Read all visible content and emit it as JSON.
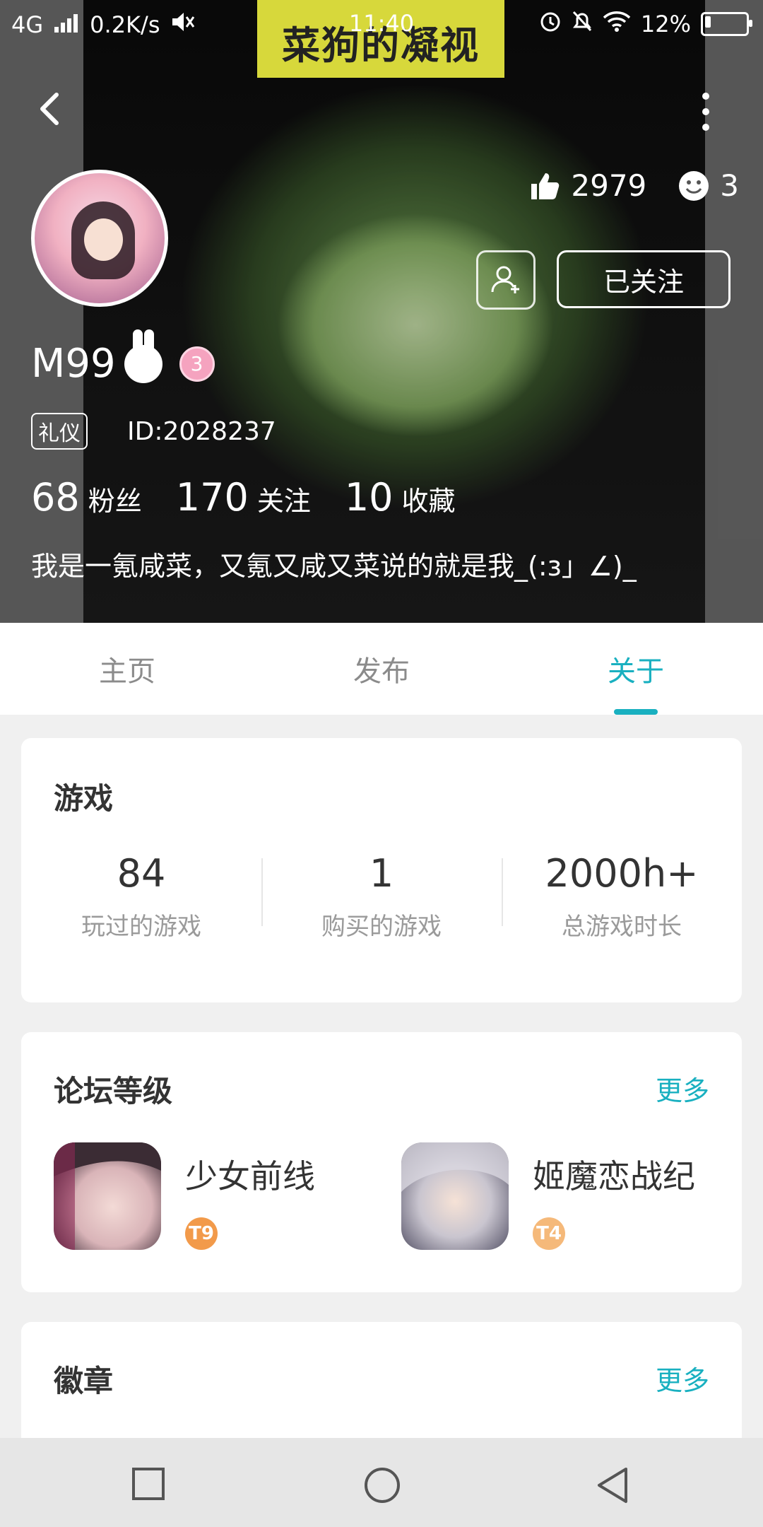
{
  "status_bar": {
    "network": "4G",
    "speed": "0.2K/s",
    "time": "11:40",
    "battery": "12%"
  },
  "header": {
    "overlay_title": "菜狗的凝视",
    "likes": "2979",
    "reactions": "3",
    "follow_label": "已关注",
    "username": "M99",
    "level_badge": "3",
    "tag": "礼仪",
    "user_id": "ID:2028237",
    "counts": [
      {
        "num": "68",
        "label": "粉丝"
      },
      {
        "num": "170",
        "label": "关注"
      },
      {
        "num": "10",
        "label": "收藏"
      }
    ],
    "bio": "我是一氪咸菜，又氪又咸又菜说的就是我_(:з」∠)_"
  },
  "tabs": [
    {
      "label": "主页",
      "active": false
    },
    {
      "label": "发布",
      "active": false
    },
    {
      "label": "关于",
      "active": true
    }
  ],
  "games_card": {
    "title": "游戏",
    "stats": [
      {
        "num": "84",
        "label": "玩过的游戏"
      },
      {
        "num": "1",
        "label": "购买的游戏"
      },
      {
        "num": "2000h+",
        "label": "总游戏时长"
      }
    ]
  },
  "forum_card": {
    "title": "论坛等级",
    "more": "更多",
    "items": [
      {
        "name": "少女前线",
        "level": "T9",
        "level_color": "#f29a4a"
      },
      {
        "name": "姬魔恋战纪",
        "level": "T4",
        "level_color": "#f5b97a"
      }
    ]
  },
  "badges_card": {
    "title": "徽章",
    "more": "更多"
  },
  "colors": {
    "accent": "#19b0c0"
  }
}
